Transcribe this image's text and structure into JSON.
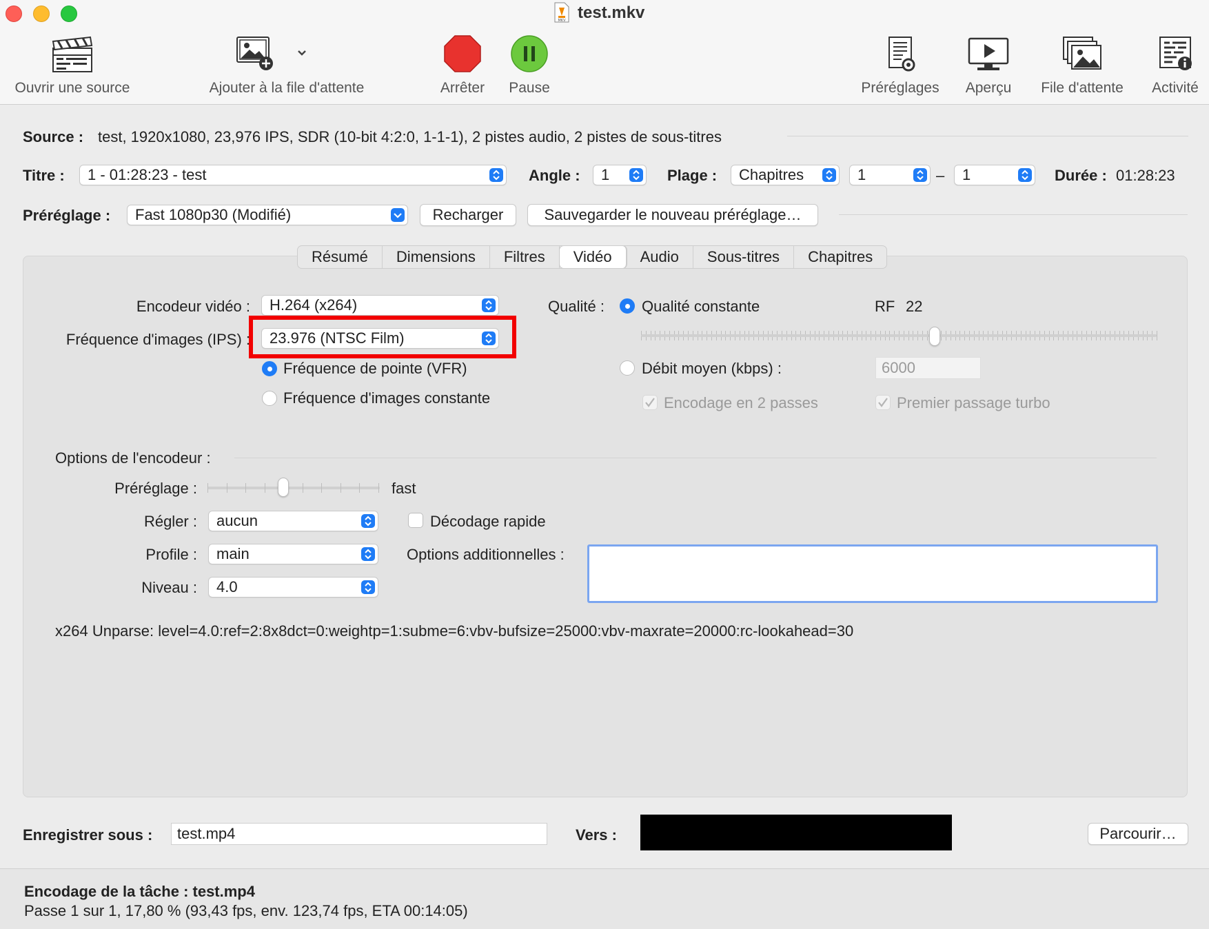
{
  "window": {
    "title": "test.mkv"
  },
  "toolbar": {
    "open_source": "Ouvrir une source",
    "add_queue": "Ajouter à la file d'attente",
    "stop": "Arrêter",
    "pause": "Pause",
    "presets": "Préréglages",
    "preview": "Aperçu",
    "queue": "File d'attente",
    "activity": "Activité"
  },
  "source": {
    "label": "Source :",
    "value": "test, 1920x1080, 23,976 IPS, SDR (10-bit 4:2:0, 1-1-1), 2 pistes audio, 2 pistes de sous-titres"
  },
  "title_row": {
    "title_label": "Titre :",
    "title_value": "1 - 01:28:23 - test",
    "angle_label": "Angle :",
    "angle_value": "1",
    "range_label": "Plage :",
    "range_type": "Chapitres",
    "range_start": "1",
    "range_sep": "–",
    "range_end": "1",
    "duration_label": "Durée :",
    "duration_value": "01:28:23"
  },
  "preset_row": {
    "label": "Préréglage :",
    "value": "Fast 1080p30 (Modifié)",
    "reload": "Recharger",
    "save_new": "Sauvegarder le nouveau préréglage…"
  },
  "tabs": [
    "Résumé",
    "Dimensions",
    "Filtres",
    "Vidéo",
    "Audio",
    "Sous-titres",
    "Chapitres"
  ],
  "active_tab": "Vidéo",
  "video": {
    "encoder_label": "Encodeur vidéo :",
    "encoder_value": "H.264 (x264)",
    "framerate_label": "Fréquence d'images (IPS) :",
    "framerate_value": "23.976 (NTSC Film)",
    "vfr_label": "Fréquence de pointe (VFR)",
    "cfr_label": "Fréquence d'images constante",
    "quality_label": "Qualité :",
    "constant_quality": "Qualité constante",
    "rf_label": "RF",
    "rf_value": "22",
    "avg_bitrate": "Débit moyen (kbps) :",
    "bitrate_value": "6000",
    "two_pass": "Encodage en 2 passes",
    "turbo": "Premier passage turbo",
    "quality_slider_fraction": 0.57
  },
  "encoder_options": {
    "section_label": "Options de l'encodeur :",
    "preset_label": "Préréglage :",
    "preset_value": "fast",
    "preset_slider_fraction": 0.44,
    "tune_label": "Régler :",
    "tune_value": "aucun",
    "fast_decode": "Décodage rapide",
    "profile_label": "Profile :",
    "profile_value": "main",
    "extra_label": "Options additionnelles :",
    "level_label": "Niveau :",
    "level_value": "4.0",
    "unparse": "x264 Unparse: level=4.0:ref=2:8x8dct=0:weightp=1:subme=6:vbv-bufsize=25000:vbv-maxrate=20000:rc-lookahead=30"
  },
  "output": {
    "save_as_label": "Enregistrer sous :",
    "filename": "test.mp4",
    "to_label": "Vers :",
    "browse": "Parcourir…"
  },
  "status": {
    "job": "Encodage de la tâche : test.mp4",
    "progress": "Passe 1 sur 1, 17,80 % (93,43 fps, env. 123,74 fps, ETA 00:14:05)"
  },
  "colors": {
    "accent": "#1f7cf6",
    "highlight": "#f20000",
    "stop": "#e8322e",
    "pause": "#6cc93e"
  },
  "icons": {
    "open_source": "clapperboard-icon",
    "add_queue": "add-photo-icon",
    "stop": "stop-octagon-icon",
    "pause": "pause-icon",
    "presets": "document-gear-icon",
    "preview": "monitor-play-icon",
    "queue": "photo-stack-icon",
    "activity": "log-info-icon"
  }
}
